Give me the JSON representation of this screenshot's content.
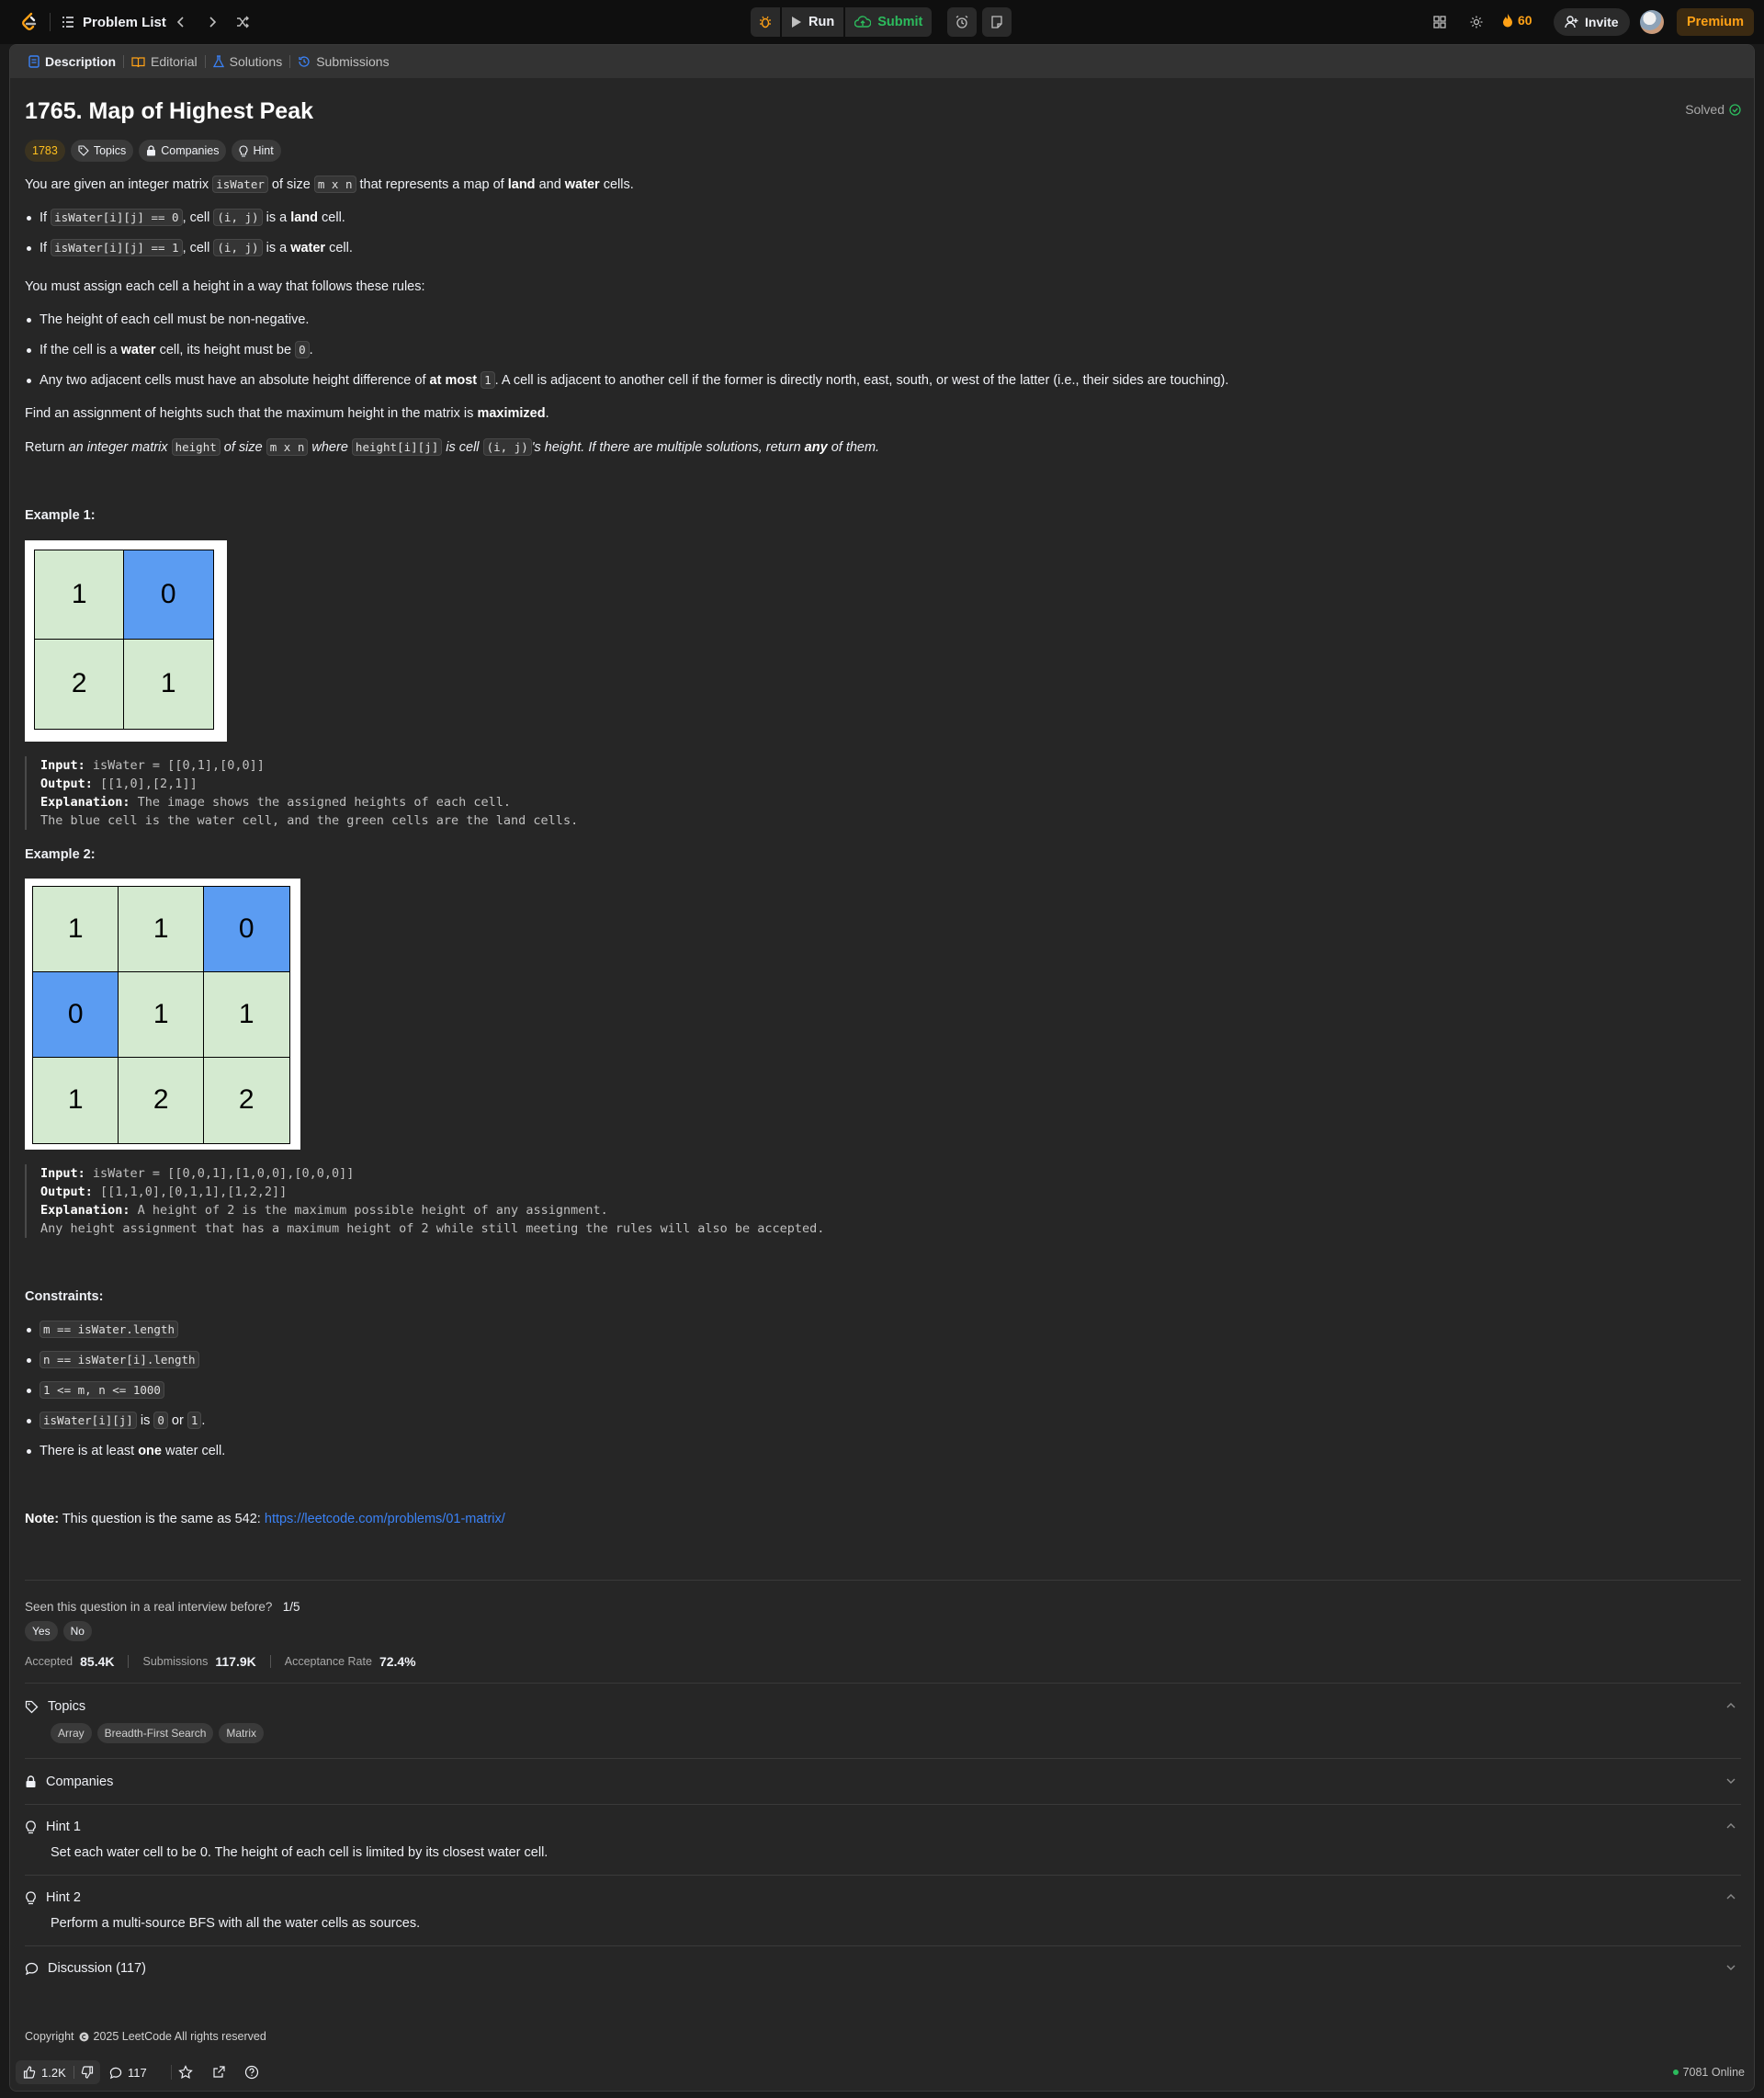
{
  "topbar": {
    "problem_list_label": "Problem List",
    "run_label": "Run",
    "submit_label": "Submit",
    "streak_count": "60",
    "invite_label": "Invite",
    "premium_label": "Premium"
  },
  "tabs": [
    {
      "label": "Description",
      "icon": "description-icon",
      "active": true
    },
    {
      "label": "Editorial",
      "icon": "book-icon",
      "active": false
    },
    {
      "label": "Solutions",
      "icon": "flask-icon",
      "active": false
    },
    {
      "label": "Submissions",
      "icon": "history-icon",
      "active": false
    }
  ],
  "problem": {
    "title": "1765. Map of Highest Peak",
    "status": "Solved",
    "rating": "1783",
    "chips": {
      "topics": "Topics",
      "companies": "Companies",
      "hint": "Hint"
    }
  },
  "description": {
    "intro": {
      "t1": "You are given an integer matrix ",
      "c1": "isWater",
      "t2": " of size ",
      "c2": "m x n",
      "t3": " that represents a map of ",
      "b1": "land",
      "t4": " and ",
      "b2": "water",
      "t5": " cells."
    },
    "bullet1": {
      "t1": "If ",
      "c1": "isWater[i][j] == 0",
      "t2": ", cell ",
      "c2": "(i, j)",
      "t3": " is a ",
      "b1": "land",
      "t4": " cell."
    },
    "bullet2": {
      "t1": "If ",
      "c1": "isWater[i][j] == 1",
      "t2": ", cell ",
      "c2": "(i, j)",
      "t3": " is a ",
      "b1": "water",
      "t4": " cell."
    },
    "rules_intro": "You must assign each cell a height in a way that follows these rules:",
    "rule1": "The height of each cell must be non-negative.",
    "rule2": {
      "t1": "If the cell is a ",
      "b1": "water",
      "t2": " cell, its height must be ",
      "c1": "0",
      "t3": "."
    },
    "rule3": {
      "t1": "Any two adjacent cells must have an absolute height difference of ",
      "b1": "at most",
      "t2": " ",
      "c1": "1",
      "t3": ". A cell is adjacent to another cell if the former is directly north, east, south, or west of the latter (i.e., their sides are touching)."
    },
    "find": {
      "t1": "Find an assignment of heights such that the maximum height in the matrix is ",
      "b1": "maximized",
      "t2": "."
    },
    "ret": {
      "t1": "Return ",
      "i1": "an integer matrix ",
      "c1": "height",
      "i2": " of size ",
      "c2": "m x n",
      "i3": " where ",
      "c3": "height[i][j]",
      "i4": " is cell ",
      "c4": "(i, j)",
      "i5": "'s height. If there are multiple solutions, return ",
      "b1": "any",
      "i6": " of them."
    }
  },
  "example1": {
    "heading": "Example 1:",
    "grid": [
      [
        "1",
        "0"
      ],
      [
        "2",
        "1"
      ]
    ],
    "water": [
      [
        false,
        true
      ],
      [
        false,
        false
      ]
    ],
    "input_label": "Input:",
    "input": " isWater = [[0,1],[0,0]]",
    "output_label": "Output:",
    "output": " [[1,0],[2,1]]",
    "expl_label": "Explanation:",
    "expl1": " The image shows the assigned heights of each cell.",
    "expl2": "The blue cell is the water cell, and the green cells are the land cells."
  },
  "example2": {
    "heading": "Example 2:",
    "grid": [
      [
        "1",
        "1",
        "0"
      ],
      [
        "0",
        "1",
        "1"
      ],
      [
        "1",
        "2",
        "2"
      ]
    ],
    "water": [
      [
        false,
        false,
        true
      ],
      [
        true,
        false,
        false
      ],
      [
        false,
        false,
        false
      ]
    ],
    "input_label": "Input:",
    "input": " isWater = [[0,0,1],[1,0,0],[0,0,0]]",
    "output_label": "Output:",
    "output": " [[1,1,0],[0,1,1],[1,2,2]]",
    "expl_label": "Explanation:",
    "expl1": " A height of 2 is the maximum possible height of any assignment.",
    "expl2": "Any height assignment that has a maximum height of 2 while still meeting the rules will also be accepted."
  },
  "constraints": {
    "heading": "Constraints:",
    "c1": "m == isWater.length",
    "c2": "n == isWater[i].length",
    "c3": "1 <= m, n <= 1000",
    "c4": {
      "c1": "isWater[i][j]",
      "t1": " is ",
      "c2": "0",
      "t2": " or ",
      "c3": "1",
      "t3": "."
    },
    "c5": {
      "t1": "There is at least ",
      "b1": "one",
      "t2": " water cell."
    }
  },
  "note": {
    "label": "Note:",
    "text": " This question is the same as 542: ",
    "link": "https://leetcode.com/problems/01-matrix/"
  },
  "interview": {
    "question": "Seen this question in a real interview before?",
    "ratio": "1/5",
    "yes": "Yes",
    "no": "No"
  },
  "stats": {
    "accepted_label": "Accepted",
    "accepted": "85.4K",
    "submissions_label": "Submissions",
    "submissions": "117.9K",
    "rate_label": "Acceptance Rate",
    "rate": "72.4%"
  },
  "sections": {
    "topics": "Topics",
    "topic_tags": [
      "Array",
      "Breadth-First Search",
      "Matrix"
    ],
    "companies": "Companies",
    "hint1_title": "Hint 1",
    "hint1_text": "Set each water cell to be 0. The height of each cell is limited by its closest water cell.",
    "hint2_title": "Hint 2",
    "hint2_text": "Perform a multi-source BFS with all the water cells as sources.",
    "discussion": "Discussion (117)"
  },
  "footer": {
    "copyright_prefix": "Copyright",
    "copyright_text": "2025 LeetCode All rights reserved"
  },
  "bottombar": {
    "likes": "1.2K",
    "comments": "117",
    "online": "7081 Online"
  },
  "colors": {
    "accent_orange": "#ffa116",
    "submit_green": "#2cbb5d",
    "link_blue": "#3b82f6",
    "water_blue": "#5b9cf2",
    "land_green": "#d4ead0"
  }
}
